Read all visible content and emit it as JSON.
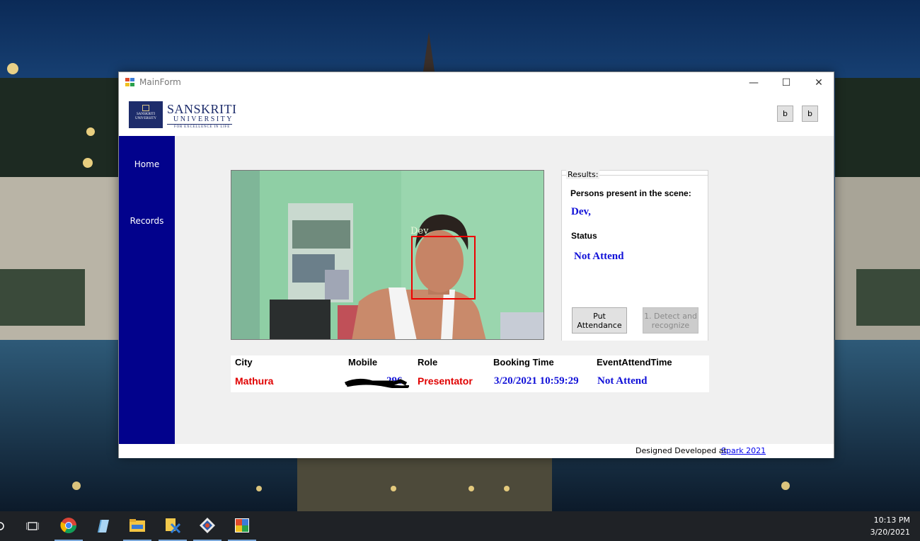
{
  "window": {
    "title": "MainForm",
    "controls": {
      "minimize": "—",
      "maximize": "☐",
      "close": "✕"
    }
  },
  "header": {
    "logo_seal_text": "SANSKRITI UNIVERSITY",
    "logo_name": "SANSKRITI",
    "logo_sub": "UNIVERSITY",
    "logo_tagline": "FOR EXCELLENCE IN LIFE",
    "button_1": "b",
    "button_2": "b"
  },
  "sidebar": {
    "items": [
      {
        "label": "Home"
      },
      {
        "label": "Records"
      }
    ]
  },
  "camera": {
    "detected_label": "Dev"
  },
  "results": {
    "legend": "Results:",
    "persons_label": "Persons present in the scene:",
    "persons_value": "Dev,",
    "status_label": "Status",
    "status_value": "Not Attend",
    "put_attendance_button": "Put Attendance",
    "detect_button": "1. Detect and recognize"
  },
  "table": {
    "headers": [
      "City",
      "Mobile",
      "Role",
      "Booking Time",
      "EventAttendTime"
    ],
    "row": {
      "city": "Mathura",
      "mobile": "296",
      "role": "Presentator",
      "booking_time": "3/20/2021 10:59:29",
      "event_attend_time": "Not Attend"
    }
  },
  "footer": {
    "text": "Designed  Developed at",
    "link": "Spark 2021"
  },
  "taskbar": {
    "apps": [
      "search-icon",
      "task-view-icon",
      "chrome-icon",
      "notepad-icon",
      "file-explorer-icon",
      "app-icon",
      "git-icon",
      "winforms-app-icon"
    ],
    "time": "10:13 PM",
    "date": "3/20/2021"
  },
  "colors": {
    "sidebar": "#02028c",
    "value_blue": "#1010d8",
    "value_red": "#e00000",
    "face_box": "#ee0000"
  }
}
